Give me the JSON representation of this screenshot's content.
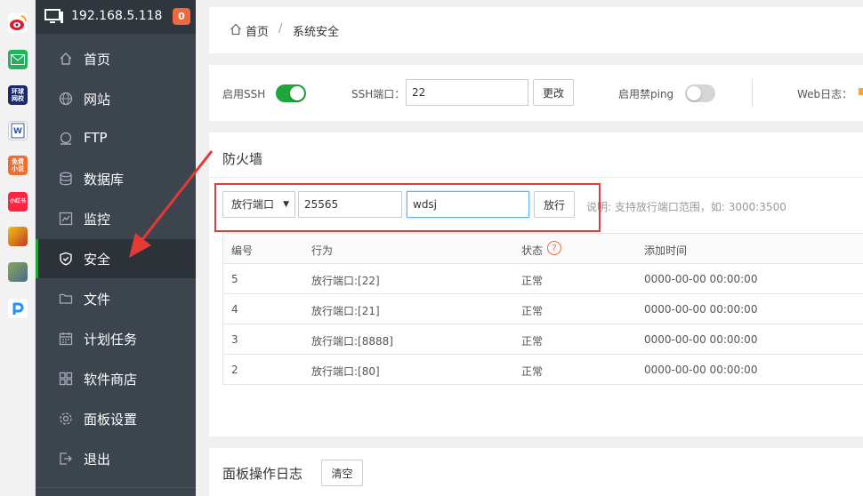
{
  "apps": [
    {
      "icon": "weibo-icon",
      "color": "#e6162d"
    },
    {
      "icon": "mail-icon",
      "color": "#21b35b"
    },
    {
      "icon": "news-app-icon",
      "color": "#1a2a6c",
      "text": "环球\n网校"
    },
    {
      "icon": "word-doc-icon",
      "color": "#2b579a"
    },
    {
      "icon": "novel-app-icon",
      "color": "#f46b2a",
      "text": "免费\n小说"
    },
    {
      "icon": "xiaohongshu-icon",
      "color": "#ff2442",
      "text": "小红书"
    },
    {
      "icon": "game-app-icon",
      "color": "#c0392b"
    },
    {
      "icon": "game2-app-icon",
      "color": "#6d8a4a"
    },
    {
      "icon": "p-app-icon",
      "color": "#ffffff"
    }
  ],
  "server": {
    "ip": "192.168.5.118",
    "badge": "0"
  },
  "nav": [
    {
      "label": "首页",
      "icon": "home-icon"
    },
    {
      "label": "网站",
      "icon": "globe-icon"
    },
    {
      "label": "FTP",
      "icon": "ftp-icon"
    },
    {
      "label": "数据库",
      "icon": "database-icon"
    },
    {
      "label": "监控",
      "icon": "monitor-icon"
    },
    {
      "label": "安全",
      "icon": "shield-icon",
      "active": true
    },
    {
      "label": "文件",
      "icon": "folder-icon"
    },
    {
      "label": "计划任务",
      "icon": "calendar-icon"
    },
    {
      "label": "软件商店",
      "icon": "apps-icon"
    },
    {
      "label": "面板设置",
      "icon": "settings-icon"
    },
    {
      "label": "退出",
      "icon": "logout-icon"
    }
  ],
  "breadcrumb": {
    "home": "首页",
    "separator": "/",
    "current": "系统安全"
  },
  "settings": {
    "ssh_label": "启用SSH",
    "ssh_enabled": true,
    "ssh_port_label": "SSH端口：",
    "ssh_port_value": "22",
    "change_button": "更改",
    "ping_label": "启用禁ping",
    "ping_enabled": false,
    "weblog_label": "Web日志："
  },
  "firewall": {
    "title": "防火墙",
    "action_select": "放行端口",
    "port_value": "25565",
    "remark_value": "wdsj",
    "allow_button": "放行",
    "note": "说明: 支持放行端口范围，如: 3000:3500",
    "columns": [
      "编号",
      "行为",
      "状态",
      "添加时间"
    ],
    "rows": [
      {
        "id": "5",
        "action": "放行端口:[22]",
        "status": "正常",
        "time": "0000-00-00 00:00:00"
      },
      {
        "id": "4",
        "action": "放行端口:[21]",
        "status": "正常",
        "time": "0000-00-00 00:00:00"
      },
      {
        "id": "3",
        "action": "放行端口:[8888]",
        "status": "正常",
        "time": "0000-00-00 00:00:00"
      },
      {
        "id": "2",
        "action": "放行端口:[80]",
        "status": "正常",
        "time": "0000-00-00 00:00:00"
      }
    ]
  },
  "oplog": {
    "title": "面板操作日志",
    "clear_button": "清空"
  },
  "colors": {
    "accent": "#20a53a",
    "sidebar": "#3c444d",
    "badge": "#f0683e",
    "annotation": "#e53935"
  }
}
